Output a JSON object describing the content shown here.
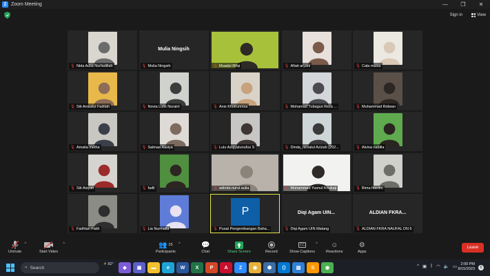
{
  "window": {
    "title": "Zoom Meeting"
  },
  "topbar": {
    "sign_in": "Sign in",
    "view": "View"
  },
  "tiles": [
    {
      "name": "Nida Aulia Nurfadillah",
      "type": "video",
      "bg": "#d9d6d0",
      "fg": "#6b6b6b"
    },
    {
      "name": "Mulia Ningsih",
      "type": "name",
      "label": "Mulia Ningsih"
    },
    {
      "name": "Muadzi Rifqi",
      "type": "wide",
      "bg": "#a7c23a",
      "fg": "#2e2a26"
    },
    {
      "name": "Afiati aryani",
      "type": "video",
      "bg": "#e8e0dc",
      "fg": "#7a5a4a"
    },
    {
      "name": "Cala maisa",
      "type": "video",
      "bg": "#ece8e2",
      "fg": "#d9c8b6"
    },
    {
      "name": "Siti Anisatul Fadilah",
      "type": "video",
      "bg": "#e8b94a",
      "fg": "#8d6d57"
    },
    {
      "name": "Novia Lutis Nuraini",
      "type": "video",
      "bg": "#d0d2ce",
      "fg": "#3c3c3c"
    },
    {
      "name": "Anis Khoirunnisa",
      "type": "video",
      "bg": "#d8d2c8",
      "fg": "#c7a27c"
    },
    {
      "name": "Mohamad Tubagus Reza ...",
      "type": "video",
      "bg": "#d4d7d9",
      "fg": "#4a4a50"
    },
    {
      "name": "Muhammad Ridwan",
      "type": "video",
      "bg": "#5a5048",
      "fg": "#2d2724"
    },
    {
      "name": "Amalia metha",
      "type": "video",
      "bg": "#c9c7c2",
      "fg": "#3a3f4a"
    },
    {
      "name": "Salmaa Aasiya",
      "type": "video",
      "bg": "#dedad6",
      "fg": "#7e6b5f"
    },
    {
      "name": "Lulu Azqiyatunufus S",
      "type": "video",
      "bg": "#c8c6c4",
      "fg": "#3d3634"
    },
    {
      "name": "Dinda_niroatul Azizah (202...",
      "type": "video",
      "bg": "#cfd6d8",
      "fg": "#3a3a3a"
    },
    {
      "name": "Alvina nabilla",
      "type": "video",
      "bg": "#5fa94f",
      "fg": "#2a2420"
    },
    {
      "name": "Siti Aisyah",
      "type": "video",
      "bg": "#d6d4d0",
      "fg": "#9c2b2b"
    },
    {
      "name": "fadli",
      "type": "video",
      "bg": "#4f8f3f",
      "fg": "#2e2621"
    },
    {
      "name": "adinda nurul aulia",
      "type": "wide",
      "bg": "#b8b2aa",
      "fg": "#8c847a"
    },
    {
      "name": "Muhammad Yusnul Khuluqi",
      "type": "wide",
      "bg": "#f2f2f0",
      "fg": "#2d2a28"
    },
    {
      "name": "Bima fitardhi",
      "type": "video",
      "bg": "#d0d0cc",
      "fg": "#6e6e68"
    },
    {
      "name": "Fadhlan Fatih",
      "type": "video",
      "bg": "#8c8c86",
      "fg": "#2e2e2e"
    },
    {
      "name": "Lia Nurmalia",
      "type": "video",
      "bg": "#5f7dd8",
      "fg": "#e8e2f2"
    },
    {
      "name": "Pusat Pengembangan Baha...",
      "type": "pbox",
      "letter": "P",
      "active": true
    },
    {
      "name": "Diqi Agam UIN Malang",
      "type": "name",
      "label": "Diqi Agam UIN..."
    },
    {
      "name": "ALDIAN FKRA NAUFAL DN 6",
      "type": "name",
      "label": "ALDIAN FKRA..."
    }
  ],
  "toolbar": {
    "unmute": "Unmute",
    "start_video": "Start Video",
    "participants": "Participants",
    "participants_count": "25",
    "chat": "Chat",
    "share_screen": "Share Screen",
    "record": "Record",
    "show_captions": "Show Captions",
    "reactions": "Reactions",
    "apps": "Apps",
    "leave": "Leave",
    "cc": "CC"
  },
  "taskbar": {
    "search": "Search",
    "weather": "82°",
    "time": "2:00 PM",
    "date": "8/15/2023",
    "notifications": "6",
    "apps": [
      {
        "name": "Copilot",
        "bg": "#7b5cd6",
        "glyph": "◆"
      },
      {
        "name": "Teams",
        "bg": "#5b5fc7",
        "glyph": "▣"
      },
      {
        "name": "File Explorer",
        "bg": "#f2c12e",
        "glyph": "▬"
      },
      {
        "name": "Edge",
        "bg": "#1fa3d6",
        "glyph": "e"
      },
      {
        "name": "Word",
        "bg": "#2b579a",
        "glyph": "W"
      },
      {
        "name": "Excel",
        "bg": "#217346",
        "glyph": "X"
      },
      {
        "name": "PowerPoint",
        "bg": "#d24726",
        "glyph": "P"
      },
      {
        "name": "Adobe Acrobat",
        "bg": "#c8102e",
        "glyph": "A"
      },
      {
        "name": "Zoom",
        "bg": "#2d8cff",
        "glyph": "Z"
      },
      {
        "name": "Chrome",
        "bg": "#e8b23a",
        "glyph": "◉"
      },
      {
        "name": "Security",
        "bg": "#3a6ea5",
        "glyph": "⬢"
      },
      {
        "name": "VS Code",
        "bg": "#0078d4",
        "glyph": "⟨⟩"
      },
      {
        "name": "Photos",
        "bg": "#2f7fd6",
        "glyph": "▧"
      },
      {
        "name": "Sublime",
        "bg": "#ff9800",
        "glyph": "S"
      },
      {
        "name": "Chrome 2",
        "bg": "#4caf50",
        "glyph": "◉"
      }
    ]
  }
}
